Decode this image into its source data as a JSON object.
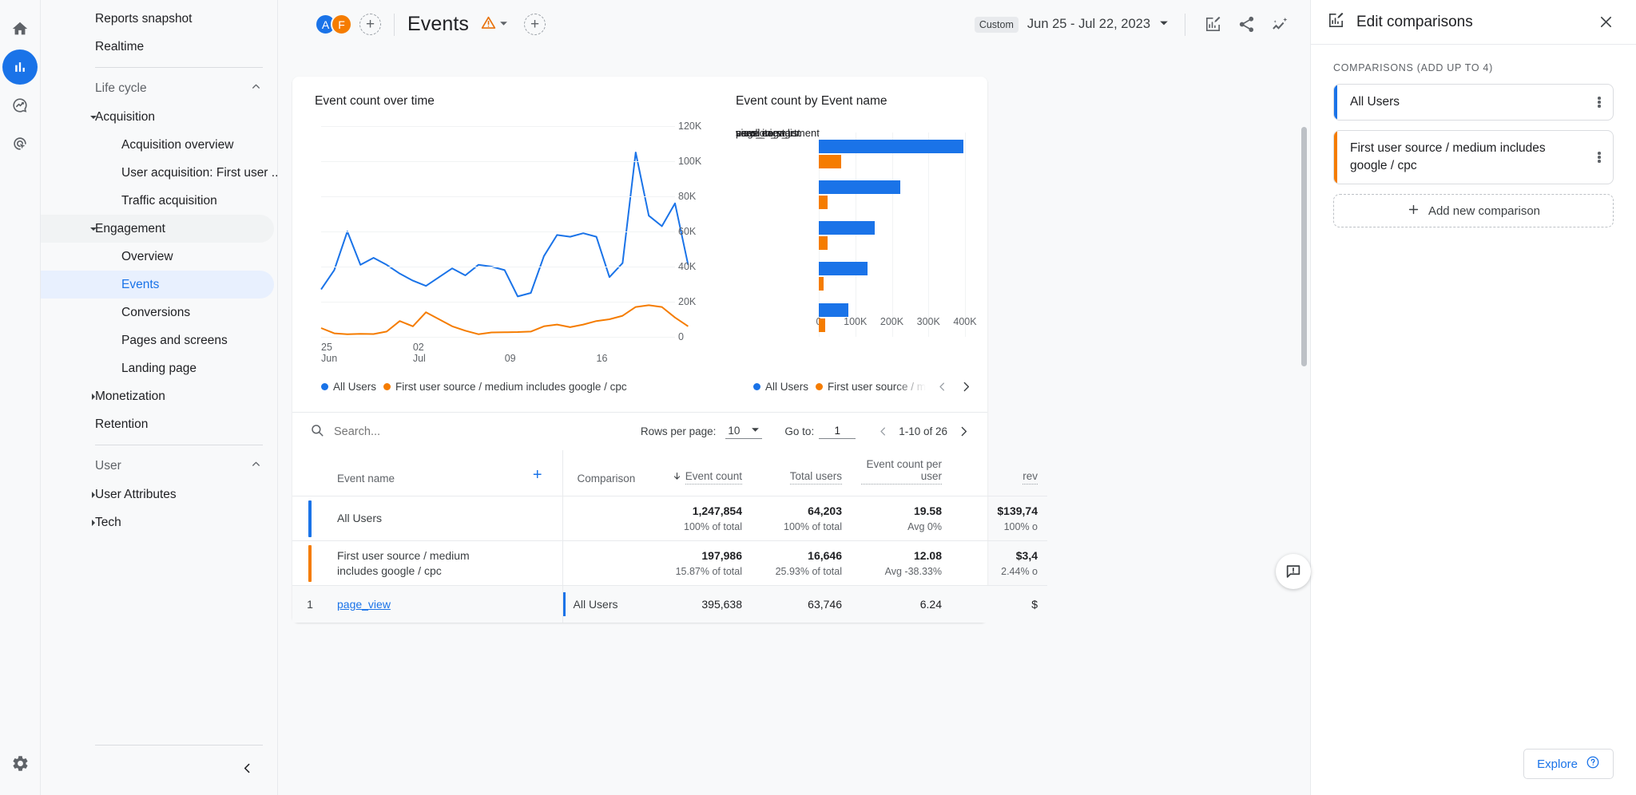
{
  "rail": {
    "items": [
      {
        "name": "home-icon",
        "label": "Home"
      },
      {
        "name": "reports-icon",
        "label": "Reports"
      },
      {
        "name": "explore-icon",
        "label": "Explore"
      },
      {
        "name": "advertising-icon",
        "label": "Advertising"
      }
    ],
    "settings_label": "Admin"
  },
  "sidebar": {
    "top_items": [
      {
        "label": "Reports snapshot"
      },
      {
        "label": "Realtime"
      }
    ],
    "sections": [
      {
        "label": "Life cycle",
        "groups": [
          {
            "label": "Acquisition",
            "expanded": true,
            "items": [
              {
                "label": "Acquisition overview"
              },
              {
                "label": "User acquisition: First user ..."
              },
              {
                "label": "Traffic acquisition"
              }
            ]
          },
          {
            "label": "Engagement",
            "expanded": true,
            "items": [
              {
                "label": "Overview"
              },
              {
                "label": "Events",
                "selected": true
              },
              {
                "label": "Conversions"
              },
              {
                "label": "Pages and screens"
              },
              {
                "label": "Landing page"
              }
            ]
          },
          {
            "label": "Monetization",
            "expanded": false,
            "items": []
          },
          {
            "label": "Retention",
            "expanded": null,
            "items": []
          }
        ]
      },
      {
        "label": "User",
        "groups": [
          {
            "label": "User Attributes",
            "expanded": false,
            "items": []
          },
          {
            "label": "Tech",
            "expanded": false,
            "items": []
          }
        ]
      }
    ]
  },
  "topbar": {
    "avatars": [
      {
        "initial": "A",
        "color": "#1a73e8"
      },
      {
        "initial": "F",
        "color": "#f57c00"
      }
    ],
    "add_comparison_label": "+",
    "page_title": "Events",
    "add_title_label": "+",
    "date_preset": "Custom",
    "date_range": "Jun 25 - Jul 22, 2023"
  },
  "charts": {
    "line_title": "Event count over time",
    "bar_title": "Event count by Event name",
    "legend": [
      {
        "label": "All Users",
        "color": "#1a73e8"
      },
      {
        "label": "First user source / medium includes google / cpc",
        "color": "#f57c00"
      }
    ],
    "bar_legend": [
      {
        "label": "All Users",
        "color": "#1a73e8"
      },
      {
        "label": "First user source / m",
        "color": "#f57c00"
      }
    ]
  },
  "chart_data": [
    {
      "type": "line",
      "title": "Event count over time",
      "xlabel": "",
      "ylabel": "",
      "ylim": [
        0,
        120000
      ],
      "yticks": [
        0,
        20000,
        40000,
        60000,
        80000,
        100000,
        120000
      ],
      "ytick_labels": [
        "0",
        "20K",
        "40K",
        "60K",
        "80K",
        "100K",
        "120K"
      ],
      "xticks": [
        0,
        7,
        14,
        21
      ],
      "xtick_labels": [
        "25\nJun",
        "02\nJul",
        "09",
        "16"
      ],
      "grid": true,
      "legend_position": "bottom-left",
      "x": [
        0,
        1,
        2,
        3,
        4,
        5,
        6,
        7,
        8,
        9,
        10,
        11,
        12,
        13,
        14,
        15,
        16,
        17,
        18,
        19,
        20,
        21,
        22,
        23,
        24,
        25,
        26,
        27
      ],
      "series": [
        {
          "name": "All Users",
          "color": "#1a73e8",
          "values": [
            27000,
            38000,
            60000,
            41000,
            45000,
            41000,
            36000,
            32000,
            29000,
            34000,
            39000,
            35000,
            41000,
            40000,
            38000,
            23000,
            25000,
            46000,
            58000,
            57000,
            59000,
            57000,
            34000,
            42000,
            105000,
            69000,
            63000,
            76000,
            41000
          ]
        },
        {
          "name": "First user source / medium includes google / cpc",
          "color": "#f57c00",
          "values": [
            5000,
            2000,
            1500,
            1700,
            1600,
            3000,
            9000,
            6000,
            14000,
            10000,
            6000,
            3500,
            1500,
            2500,
            2600,
            2700,
            3000,
            6000,
            7000,
            5500,
            7000,
            9000,
            10000,
            12000,
            17000,
            18000,
            17000,
            11000,
            6000
          ]
        }
      ]
    },
    {
      "type": "bar",
      "title": "Event count by Event name",
      "orientation": "horizontal",
      "categories": [
        "page_view",
        "user_engagement",
        "view_item_list",
        "scroll",
        "session_start"
      ],
      "xlim": [
        0,
        400000
      ],
      "xticks": [
        0,
        100000,
        200000,
        300000,
        400000
      ],
      "xtick_labels": [
        "0",
        "100K",
        "200K",
        "300K",
        "400K"
      ],
      "grid": true,
      "series": [
        {
          "name": "All Users",
          "color": "#1a73e8",
          "values": [
            395638,
            222000,
            152000,
            133000,
            80000
          ]
        },
        {
          "name": "First user source / m",
          "color": "#f57c00",
          "values": [
            62000,
            25000,
            25000,
            14000,
            17000
          ]
        }
      ]
    }
  ],
  "table": {
    "search_placeholder": "Search...",
    "rows_per_page_label": "Rows per page:",
    "rows_per_page_value": "10",
    "goto_label": "Go to:",
    "goto_value": "1",
    "range_label": "1-10 of 26",
    "headers": {
      "dimension": "Event name",
      "add_dimension": "+",
      "comparison": "Comparison",
      "metrics": [
        {
          "label": "Event count",
          "sorted": true,
          "sort_dir": "desc"
        },
        {
          "label": "Total users"
        },
        {
          "label": "Event count per user"
        },
        {
          "label": "rev"
        }
      ]
    },
    "totals": [
      {
        "color": "#1a73e8",
        "name": "All Users",
        "cells": [
          {
            "value": "1,247,854",
            "sub": "100% of total"
          },
          {
            "value": "64,203",
            "sub": "100% of total"
          },
          {
            "value": "19.58",
            "sub": "Avg 0%"
          },
          {
            "value": "$139,74",
            "sub": "100% o"
          }
        ]
      },
      {
        "color": "#f57c00",
        "name": "First user source / medium includes google / cpc",
        "cells": [
          {
            "value": "197,986",
            "sub": "15.87% of total"
          },
          {
            "value": "16,646",
            "sub": "25.93% of total"
          },
          {
            "value": "12.08",
            "sub": "Avg -38.33%"
          },
          {
            "value": "$3,4",
            "sub": "2.44% o"
          }
        ]
      }
    ],
    "rows": [
      {
        "index": "1",
        "name": "page_view",
        "comparison": "All Users",
        "comparison_color": "#1a73e8",
        "cells": [
          "395,638",
          "63,746",
          "6.24",
          "$"
        ]
      }
    ]
  },
  "panel": {
    "title": "Edit comparisons",
    "section_label": "COMPARISONS (ADD UP TO 4)",
    "comparisons": [
      {
        "label": "All Users",
        "color": "#1a73e8"
      },
      {
        "label": "First user source / medium includes google / cpc",
        "color": "#f57c00"
      }
    ],
    "add_label": "Add new comparison",
    "explore_label": "Explore"
  }
}
